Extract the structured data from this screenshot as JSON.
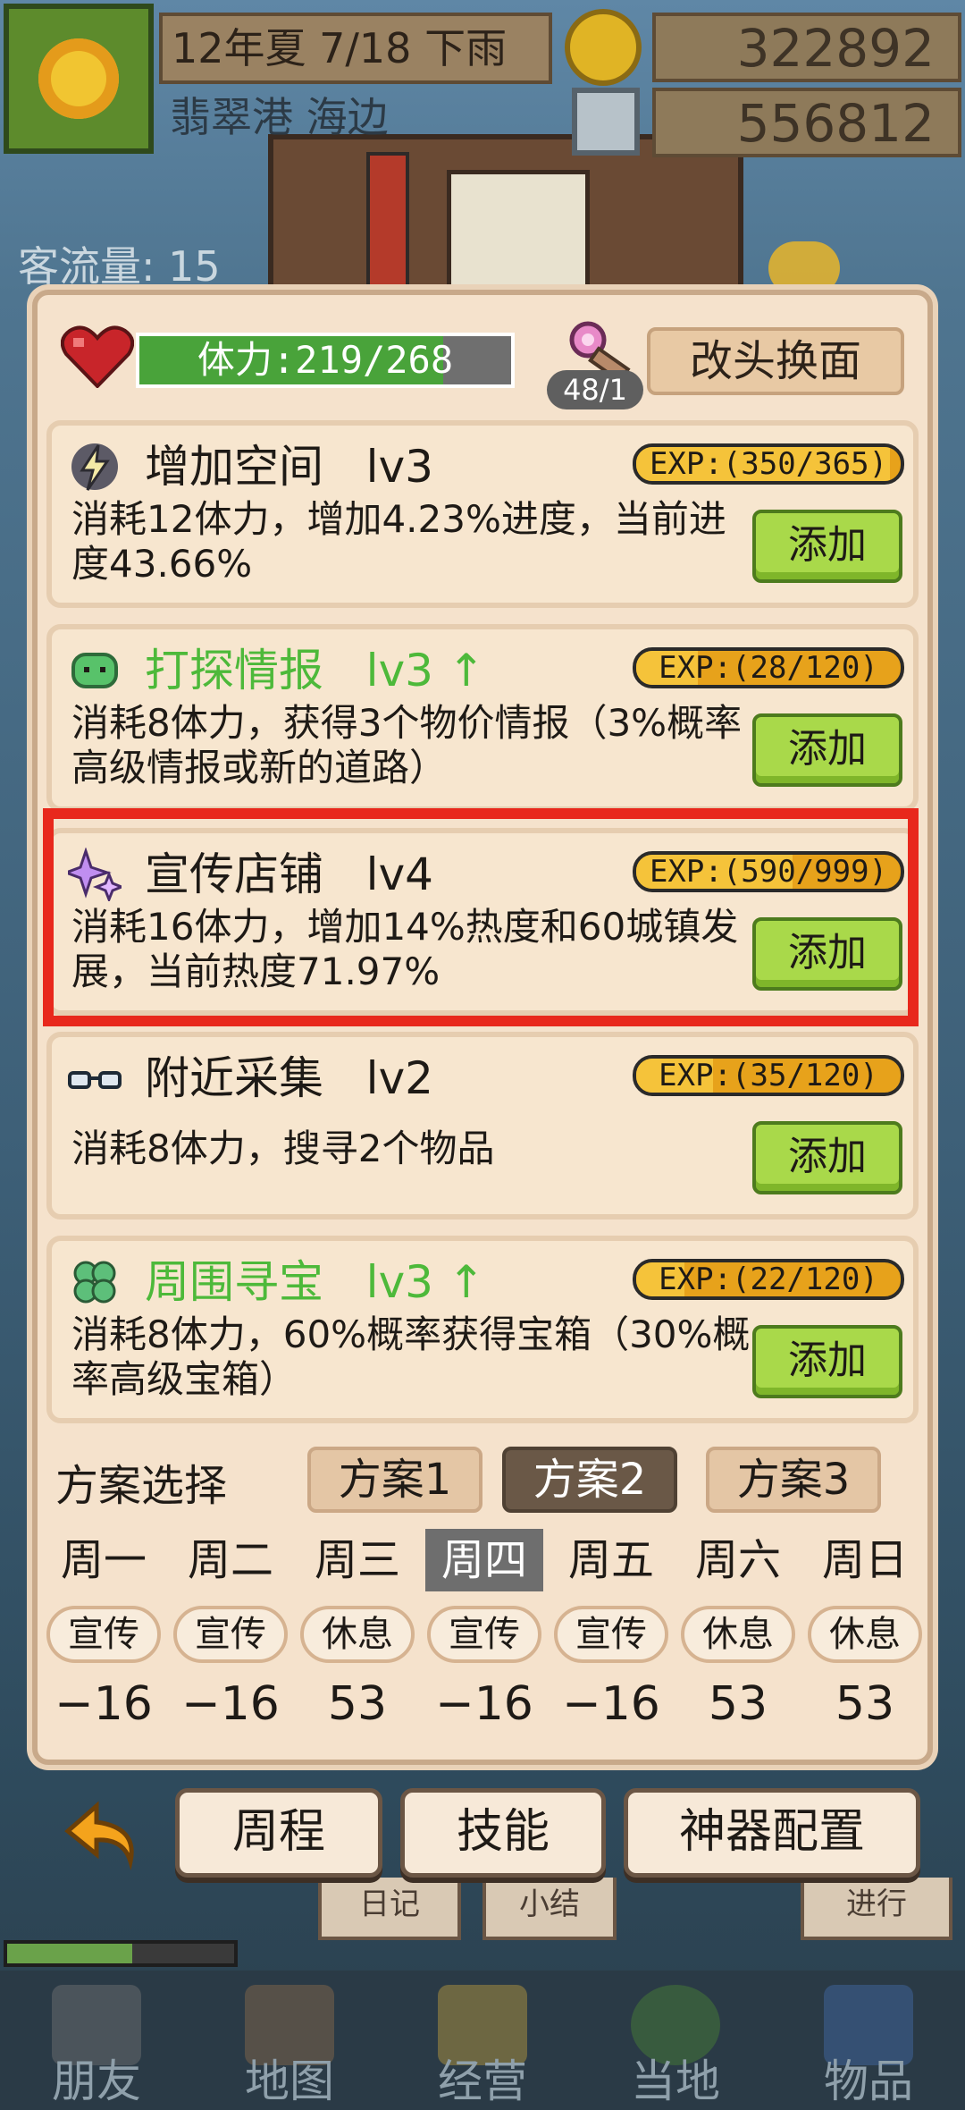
{
  "hud": {
    "date": "12年夏 7/18 下雨",
    "location": "翡翠港 海边",
    "money": "322892",
    "gems": "556812",
    "traffic": "客流量: 15"
  },
  "stamina": {
    "label": "体力:219/268",
    "current": 219,
    "max": 268
  },
  "key": {
    "count": "48/1"
  },
  "header": {
    "change_button": "改头换面"
  },
  "cards": [
    {
      "title": "增加空间   lv3",
      "exp": "EXP:(350/365)",
      "exp_ratio": 0.959,
      "desc": "消耗12体力，增加4.23%进度，当前进度43.66%",
      "add": "添加",
      "icon": "lightning-icon",
      "green": false
    },
    {
      "title": "打探情报   lv3 ↑",
      "exp": "EXP:(28/120)",
      "exp_ratio": 0.233,
      "desc": "消耗8体力，获得3个物价情报（3%概率高级情报或新的道路）",
      "add": "添加",
      "icon": "chat-bubble-icon",
      "green": true
    },
    {
      "title": "宣传店铺   lv4",
      "exp": "EXP:(590/999)",
      "exp_ratio": 0.59,
      "desc": "消耗16体力，增加14%热度和60城镇发展，当前热度71.97%",
      "add": "添加",
      "icon": "sparkle-icon",
      "green": false
    },
    {
      "title": "附近采集   lv2",
      "exp": "EXP:(35/120)",
      "exp_ratio": 0.292,
      "desc": "消耗8体力，搜寻2个物品",
      "add": "添加",
      "icon": "glasses-icon",
      "green": false
    },
    {
      "title": "周围寻宝   lv3 ↑",
      "exp": "EXP:(22/120)",
      "exp_ratio": 0.183,
      "desc": "消耗8体力，60%概率获得宝箱（30%概率高级宝箱）",
      "add": "添加",
      "icon": "clover-icon",
      "green": true
    }
  ],
  "plan": {
    "label": "方案选择",
    "options": [
      "方案1",
      "方案2",
      "方案3"
    ],
    "selected_index": 1
  },
  "schedule": {
    "days": [
      "周一",
      "周二",
      "周三",
      "周四",
      "周五",
      "周六",
      "周日"
    ],
    "today_index": 3,
    "activities": [
      "宣传",
      "宣传",
      "休息",
      "宣传",
      "宣传",
      "休息",
      "休息"
    ],
    "values": [
      "−16",
      "−16",
      "53",
      "−16",
      "−16",
      "53",
      "53"
    ]
  },
  "bottom": {
    "weekly": "周程",
    "skills": "技能",
    "artifact": "神器配置",
    "under": [
      "日记",
      "小结",
      "进行"
    ]
  },
  "nav": [
    "朋友",
    "地图",
    "经营",
    "当地",
    "物品"
  ],
  "colors": {
    "accent_red": "#e8281c",
    "green_text": "#4db93a",
    "add_button": "#a9d94a"
  }
}
